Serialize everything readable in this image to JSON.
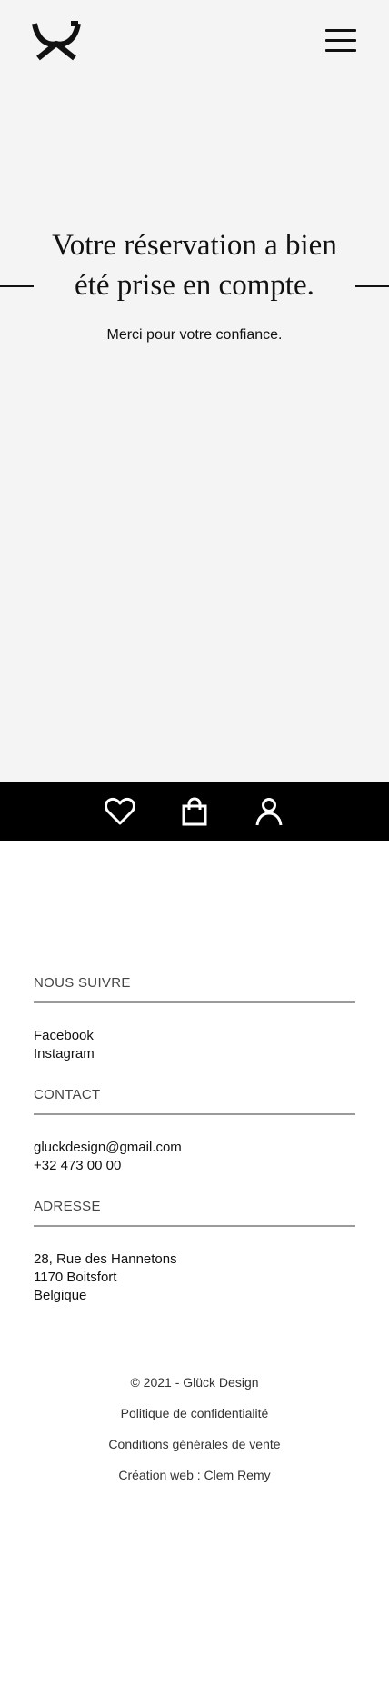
{
  "header": {
    "logo_icon": "gluck-design-logo",
    "menu_icon": "hamburger-menu-icon"
  },
  "hero": {
    "title": "Votre réservation a bien été prise en compte.",
    "subtitle": "Merci pour votre confiance."
  },
  "iconbar": {
    "icons": [
      "heart-icon",
      "shopping-bag-icon",
      "user-icon"
    ],
    "background": "#000000"
  },
  "footer": {
    "follow": {
      "title": "NOUS SUIVRE",
      "links": [
        "Facebook",
        "Instagram"
      ]
    },
    "contact": {
      "title": "CONTACT",
      "email": "gluckdesign@gmail.com",
      "phone": "+32 473 00 00"
    },
    "address": {
      "title": "ADRESSE",
      "street": "28, Rue des Hannetons",
      "city": "1170 Boitsfort",
      "country": "Belgique"
    },
    "legal": {
      "copyright": "© 2021 - Glück Design",
      "privacy": "Politique de confidentialité",
      "terms": "Conditions générales de vente",
      "credit": "Création web : Clem Remy"
    }
  }
}
